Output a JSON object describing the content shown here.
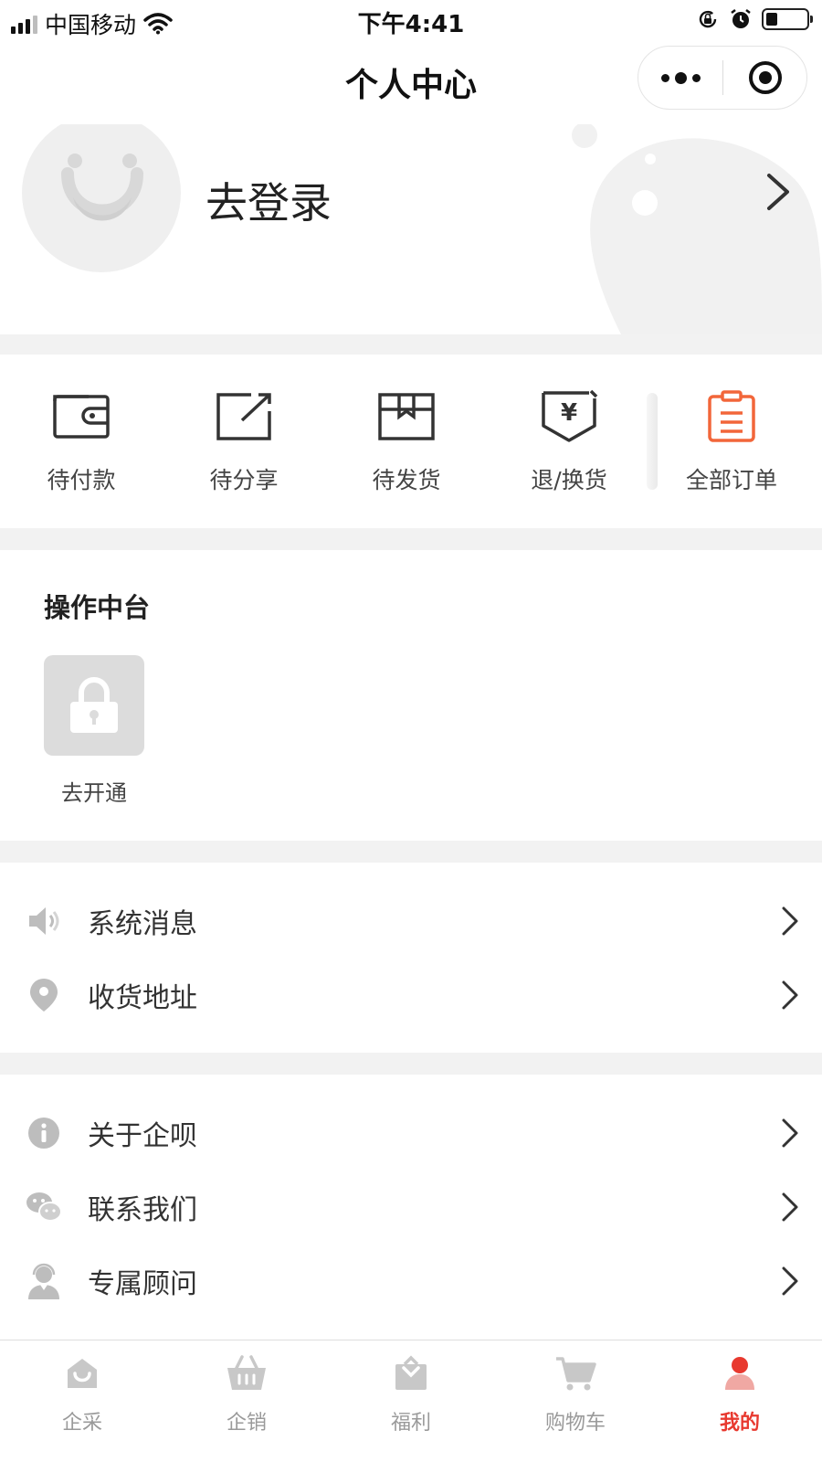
{
  "status_bar": {
    "carrier": "中国移动",
    "time": "下午4:41"
  },
  "nav": {
    "title": "个人中心"
  },
  "profile": {
    "login_label": "去登录"
  },
  "orders": [
    {
      "label": "待付款",
      "icon": "wallet-icon"
    },
    {
      "label": "待分享",
      "icon": "share-edit-icon"
    },
    {
      "label": "待发货",
      "icon": "package-icon"
    },
    {
      "label": "退/换货",
      "icon": "refund-icon"
    },
    {
      "label": "全部订单",
      "icon": "clipboard-icon"
    }
  ],
  "operation": {
    "title": "操作中台",
    "tile_label": "去开通"
  },
  "menu_group_1": [
    {
      "label": "系统消息",
      "icon": "speaker-icon"
    },
    {
      "label": "收货地址",
      "icon": "location-pin-icon"
    }
  ],
  "menu_group_2": [
    {
      "label": "关于企呗",
      "icon": "info-icon"
    },
    {
      "label": "联系我们",
      "icon": "wechat-icon"
    },
    {
      "label": "专属顾问",
      "icon": "advisor-icon"
    }
  ],
  "tabs": [
    {
      "label": "企采",
      "icon": "home-bag-icon"
    },
    {
      "label": "企销",
      "icon": "basket-icon"
    },
    {
      "label": "福利",
      "icon": "gift-icon"
    },
    {
      "label": "购物车",
      "icon": "cart-icon"
    },
    {
      "label": "我的",
      "icon": "user-icon",
      "active": true
    }
  ],
  "colors": {
    "accent": "#e8392f",
    "order_highlight": "#f2663a",
    "band": "#f2f2f2"
  }
}
